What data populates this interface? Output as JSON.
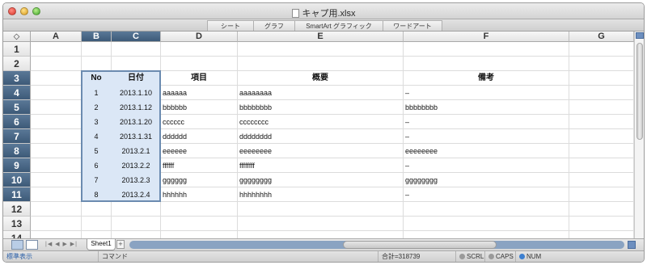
{
  "window": {
    "title": "キャプ用.xlsx"
  },
  "ribbon": {
    "tabs": [
      "シート",
      "グラフ",
      "SmartArt グラフィック",
      "ワードアート"
    ]
  },
  "corner_icon": "select-all-icon",
  "columns": [
    "A",
    "B",
    "C",
    "D",
    "E",
    "F",
    "G"
  ],
  "selected_columns": [
    "B",
    "C"
  ],
  "rows": [
    "1",
    "2",
    "3",
    "4",
    "5",
    "6",
    "7",
    "8",
    "9",
    "10",
    "11",
    "12",
    "13",
    "14"
  ],
  "selected_rows": [
    "3",
    "4",
    "5",
    "6",
    "7",
    "8",
    "9",
    "10",
    "11"
  ],
  "table": {
    "headers": {
      "no": "No",
      "date": "日付",
      "item": "項目",
      "summary": "概要",
      "note": "備考"
    },
    "rows": [
      {
        "no": "1",
        "date": "2013.1.10",
        "item": "aaaaaa",
        "summary": "aaaaaaaa",
        "note": "–"
      },
      {
        "no": "2",
        "date": "2013.1.12",
        "item": "bbbbbb",
        "summary": "bbbbbbbb",
        "note": "bbbbbbbb"
      },
      {
        "no": "3",
        "date": "2013.1.20",
        "item": "cccccc",
        "summary": "cccccccc",
        "note": "–"
      },
      {
        "no": "4",
        "date": "2013.1.31",
        "item": "dddddd",
        "summary": "dddddddd",
        "note": "–"
      },
      {
        "no": "5",
        "date": "2013.2.1",
        "item": "eeeeee",
        "summary": "eeeeeeee",
        "note": "eeeeeeee"
      },
      {
        "no": "6",
        "date": "2013.2.2",
        "item": "ffffff",
        "summary": "ffffffff",
        "note": "–"
      },
      {
        "no": "7",
        "date": "2013.2.3",
        "item": "gggggg",
        "summary": "gggggggg",
        "note": "gggggggg"
      },
      {
        "no": "8",
        "date": "2013.2.4",
        "item": "hhhhhh",
        "summary": "hhhhhhhh",
        "note": "–"
      }
    ]
  },
  "sheets": {
    "active": "Sheet1",
    "add_label": "+"
  },
  "status": {
    "view_mode": "標準表示",
    "mode": "コマンド",
    "sum": "合計=318739",
    "scrl": "SCRL",
    "caps": "CAPS",
    "num": "NUM"
  },
  "colors": {
    "selection_header": "#4a6887",
    "selection_fill": "#dbe7f6",
    "scrollbar_accent": "#8aa3c2"
  }
}
